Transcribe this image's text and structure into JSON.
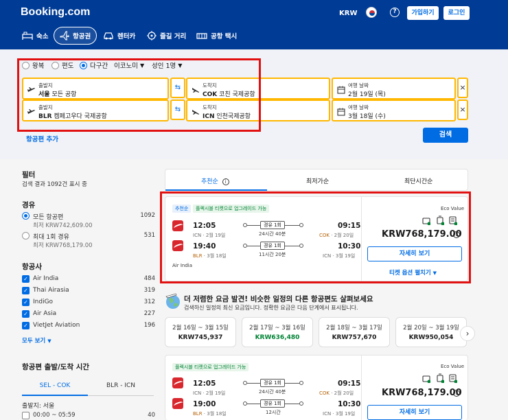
{
  "header": {
    "logo": "Booking.com",
    "currency": "KRW",
    "signup_label": "가입하기",
    "login_label": "로그인",
    "help": "?",
    "nav": [
      {
        "label": "숙소"
      },
      {
        "label": "항공권"
      },
      {
        "label": "렌터카"
      },
      {
        "label": "즐길 거리"
      },
      {
        "label": "공항 택시"
      }
    ]
  },
  "search": {
    "trip_types": [
      "왕복",
      "편도",
      "다구간"
    ],
    "selected_trip_type": "다구간",
    "cabin": "이코노미",
    "passengers": "성인 1명",
    "legs": [
      {
        "from_label": "출발지",
        "from_code": "서울",
        "from_name": "모든 공항",
        "to_label": "도착지",
        "to_code": "COK",
        "to_name": "코친 국제공항",
        "date_label": "여행 날짜",
        "date": "2월 19일 (목)"
      },
      {
        "from_label": "출발지",
        "from_code": "BLR",
        "from_name": "켐페고우다 국제공항",
        "to_label": "도착지",
        "to_code": "ICN",
        "to_name": "인천국제공항",
        "date_label": "여행 날짜",
        "date": "3월 18일 (수)"
      }
    ],
    "add_flight": "항공편 추가",
    "search_button": "검색",
    "swap_icon": "⇆",
    "remove_icon": "×"
  },
  "filters": {
    "title": "필터",
    "result_count": "검색 결과 1092건 표시 중",
    "stops": {
      "title": "경유",
      "options": [
        {
          "label": "모든 항공편",
          "sub": "최저 KRW742,609.00",
          "count": "1092",
          "selected": true
        },
        {
          "label": "최대 1회 경유",
          "sub": "최저 KRW768,179.00",
          "count": "531",
          "selected": false
        }
      ]
    },
    "airlines": {
      "title": "항공사",
      "items": [
        {
          "label": "Air India",
          "count": "484"
        },
        {
          "label": "Thai Airasia",
          "count": "319"
        },
        {
          "label": "IndiGo",
          "count": "312"
        },
        {
          "label": "Air Asia",
          "count": "227"
        },
        {
          "label": "VietJet Aviation",
          "count": "196"
        }
      ],
      "show_all": "모두 보기"
    },
    "times": {
      "title": "항공편 출발/도착 시간",
      "segments": [
        "SEL - COK",
        "BLR - ICN"
      ],
      "departure_label": "출발지: 서울",
      "first_range": "00:00 ~ 05:59",
      "first_count": "40"
    }
  },
  "sort_tabs": [
    {
      "label": "추천순",
      "info": "i"
    },
    {
      "label": "최저가순"
    },
    {
      "label": "최단시간순"
    }
  ],
  "results": [
    {
      "tag_recommend": "추천순",
      "tag_flex": "플렉시블 티켓으로 업그레이드 가능",
      "eco": "Eco Value",
      "price": "KRW768,179.00",
      "detail_button": "자세히 보기",
      "ticket_options": "티켓 옵션 펼치기",
      "airline_name": "Air India",
      "legs": [
        {
          "dep_time": "12:05",
          "dep_place": "ICN · 2월 19일",
          "stops": "경유 1회",
          "duration": "24시간 40분",
          "arr_time": "09:15",
          "arr_code": "COK",
          "arr_date": " · 2월 20일"
        },
        {
          "dep_time": "19:40",
          "dep_code": "BLR",
          "dep_date": " · 3월 18일",
          "stops": "경유 1회",
          "duration": "11시간 20분",
          "arr_time": "10:30",
          "arr_place": "ICN · 3월 19일"
        }
      ]
    },
    {
      "tag_flex": "플렉시블 티켓으로 업그레이드 가능",
      "eco": "Eco Value",
      "price": "KRW768,179.00",
      "detail_button": "자세히 보기",
      "legs": [
        {
          "dep_time": "12:05",
          "dep_place": "ICN · 2월 19일",
          "stops": "경유 1회",
          "duration": "24시간 40분",
          "arr_time": "09:15",
          "arr_code": "COK",
          "arr_date": " · 2월 20일"
        },
        {
          "dep_time": "19:00",
          "dep_code": "BLR",
          "dep_date": " · 3월 18일",
          "stops": "경유 1회",
          "duration": "12시간",
          "arr_time": "10:30",
          "arr_place": "ICN · 3월 19일"
        }
      ]
    }
  ],
  "promo": {
    "title": "더 저렴한 요금 발견! 비슷한 일정의 다른 항공편도 살펴보세요",
    "subtitle": "검색하신 일정의 최신 요금입니다. 정확한 요금은 다음 단계에서 표시됩니다.",
    "dates": [
      {
        "range": "2월 16일 ~ 3월 15일",
        "price": "KRW745,937"
      },
      {
        "range": "2월 17일 ~ 3월 16일",
        "price": "KRW636,480"
      },
      {
        "range": "2월 18일 ~ 3월 17일",
        "price": "KRW757,670"
      },
      {
        "range": "2월 20일 ~ 3월 19일",
        "price": "KRW950,054"
      }
    ],
    "next": "›"
  },
  "colors": {
    "brand": "#003b95",
    "accent": "#006ce4",
    "highlight": "#ffb700",
    "annotation": "#e21111",
    "cheap_price": "#008234"
  }
}
